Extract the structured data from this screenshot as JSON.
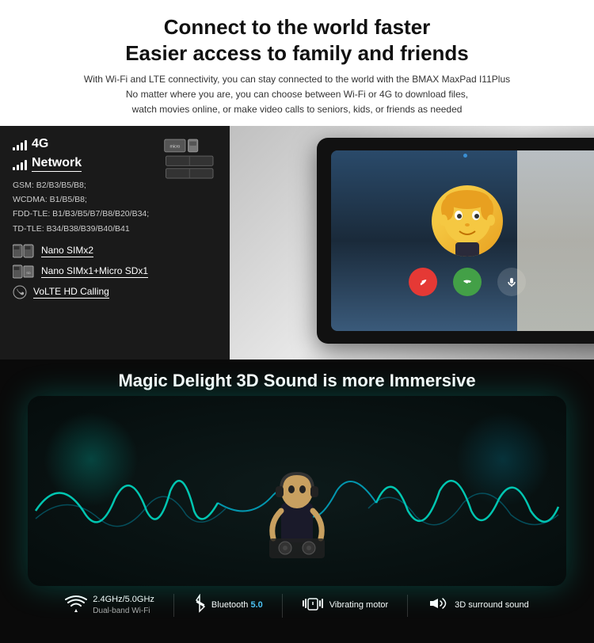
{
  "header": {
    "title_line1": "Connect to the world faster",
    "title_line2": "Easier access to family and friends",
    "subtitle": "With Wi-Fi and LTE connectivity, you can stay connected to the world with the BMAX MaxPad I11Plus\nNo matter where you are, you can choose between Wi-Fi or 4G to download files,\nwatch movies online, or make video calls to seniors, kids, or friends as needed"
  },
  "left_panel": {
    "signal_label": "4G",
    "network_label": "Network",
    "micro_sd_label": "micro",
    "details": [
      "GSM: B2/B3/B5/B8;",
      "WCDMA: B1/B5/B8;",
      "FDD-TLE: B1/B3/B5/B7/B8/B20/B34;",
      "TD-TLE: B34/B38/B39/B40/B41"
    ],
    "features": [
      {
        "label": "Nano SIMx2"
      },
      {
        "label": "Nano SIMx1+Micro SDx1"
      },
      {
        "label": "VoLTE HD Calling"
      }
    ]
  },
  "bottom": {
    "title": "Magic Delight 3D Sound is more Immersive",
    "features": [
      {
        "icon": "wifi",
        "name": "2.4GHz/5.0GHz",
        "sub": "Dual-band Wi-Fi"
      },
      {
        "icon": "bluetooth",
        "name": "Bluetooth",
        "version": "5.0",
        "sub": ""
      },
      {
        "icon": "vibrate",
        "name": "Vibrating motor",
        "sub": ""
      },
      {
        "icon": "sound",
        "name": "3D surround sound",
        "sub": ""
      }
    ]
  }
}
